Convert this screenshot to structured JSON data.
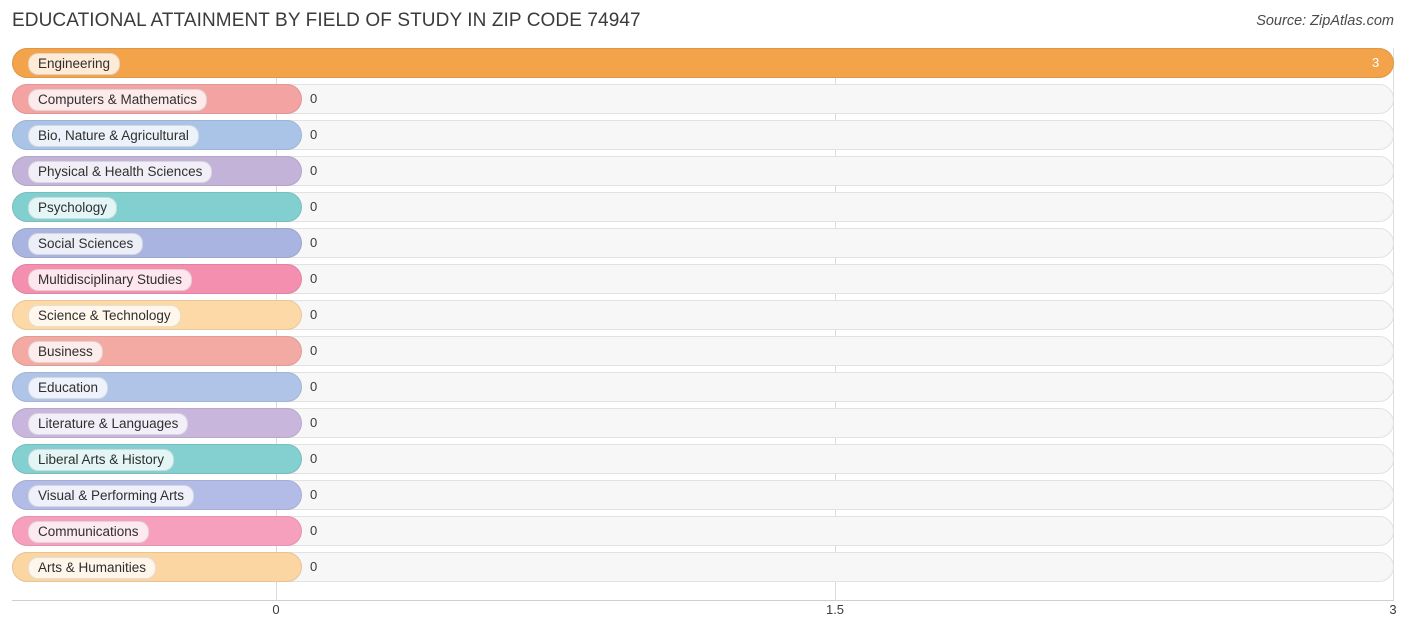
{
  "header": {
    "title": "EDUCATIONAL ATTAINMENT BY FIELD OF STUDY IN ZIP CODE 74947",
    "source": "Source: ZipAtlas.com"
  },
  "chart_data": {
    "type": "bar",
    "orientation": "horizontal",
    "title": "Educational Attainment by Field of Study in Zip Code 74947",
    "xlabel": "",
    "ylabel": "",
    "xlim": [
      0,
      3
    ],
    "ticks": [
      "0",
      "1.5",
      "3"
    ],
    "tick_values": [
      0,
      1.5,
      3
    ],
    "grid": true,
    "legend": "none",
    "categories": [
      "Engineering",
      "Computers & Mathematics",
      "Bio, Nature & Agricultural",
      "Physical & Health Sciences",
      "Psychology",
      "Social Sciences",
      "Multidisciplinary Studies",
      "Science & Technology",
      "Business",
      "Education",
      "Literature & Languages",
      "Liberal Arts & History",
      "Visual & Performing Arts",
      "Communications",
      "Arts & Humanities"
    ],
    "values": [
      3,
      0,
      0,
      0,
      0,
      0,
      0,
      0,
      0,
      0,
      0,
      0,
      0,
      0,
      0
    ],
    "value_labels": [
      "3",
      "0",
      "0",
      "0",
      "0",
      "0",
      "0",
      "0",
      "0",
      "0",
      "0",
      "0",
      "0",
      "0",
      "0"
    ],
    "bar_colors": [
      "#f5a council",
      "#f4a3a3",
      "#aac4e8",
      "#c3b3d9",
      "#82cfd0",
      "#aab4e0",
      "#f58fb0",
      "#fcd9a6",
      "#f2aaa3",
      "#b0c4e8",
      "#c9b6dd",
      "#84cfd0",
      "#b3bce6",
      "#f7a0bd",
      "#fbd5a2"
    ]
  }
}
